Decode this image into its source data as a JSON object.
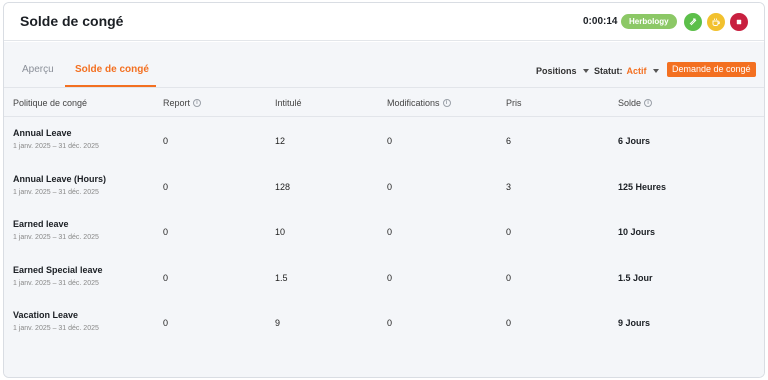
{
  "header": {
    "title": "Solde de congé",
    "timer": "0:00:14",
    "project_badge": "Herbology",
    "icons": {
      "switch": "swap-arrows-icon",
      "break": "coffee-icon",
      "stop": "stop-icon"
    },
    "colors": {
      "badge": "#8cc866",
      "switch": "#5cbf4a",
      "break": "#f2c12e",
      "stop": "#c8203f"
    }
  },
  "tabs": [
    {
      "label": "Aperçu",
      "active": false
    },
    {
      "label": "Solde de congé",
      "active": true
    }
  ],
  "filters": {
    "positions_label": "Positions",
    "statut_label": "Statut:",
    "statut_value": "Actif"
  },
  "actions": {
    "leave_request_label": "Demande de congé"
  },
  "accent_color": "#f37021",
  "table": {
    "columns": [
      "Politique de congé",
      "Report",
      "Intitulé",
      "Modifications",
      "Pris",
      "Solde"
    ],
    "rows": [
      {
        "name": "Annual Leave",
        "dates": "1 janv. 2025 – 31 déc. 2025",
        "report": "0",
        "intitule": "12",
        "modifications": "0",
        "pris": "6",
        "solde": "6 Jours"
      },
      {
        "name": "Annual Leave (Hours)",
        "dates": "1 janv. 2025 – 31 déc. 2025",
        "report": "0",
        "intitule": "128",
        "modifications": "0",
        "pris": "3",
        "solde": "125 Heures"
      },
      {
        "name": "Earned leave",
        "dates": "1 janv. 2025 – 31 déc. 2025",
        "report": "0",
        "intitule": "10",
        "modifications": "0",
        "pris": "0",
        "solde": "10 Jours"
      },
      {
        "name": "Earned Special leave",
        "dates": "1 janv. 2025 – 31 déc. 2025",
        "report": "0",
        "intitule": "1.5",
        "modifications": "0",
        "pris": "0",
        "solde": "1.5 Jour"
      },
      {
        "name": "Vacation Leave",
        "dates": "1 janv. 2025 – 31 déc. 2025",
        "report": "0",
        "intitule": "9",
        "modifications": "0",
        "pris": "0",
        "solde": "9 Jours"
      }
    ]
  }
}
